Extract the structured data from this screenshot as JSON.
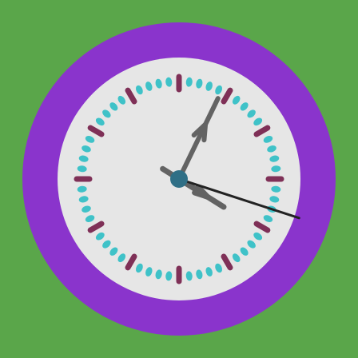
{
  "clock": {
    "time": {
      "hours": 4,
      "minutes": 4,
      "seconds": 18
    },
    "colors": {
      "background": "#5aa64a",
      "bezel": "#8a34cc",
      "face": "#e6e6e6",
      "hour_marker": "#7f3057",
      "minute_dot": "#3fc2c8",
      "hand": "#636363",
      "second_hand": "#222222",
      "center_cap": "#2f6f86"
    },
    "icons": {
      "face": "analog-clock-icon"
    }
  }
}
